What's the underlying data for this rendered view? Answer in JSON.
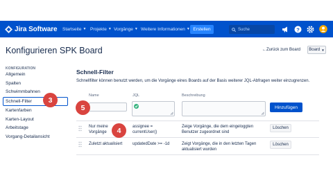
{
  "nav": {
    "logo_text": "Jira Software",
    "menu": [
      {
        "label": "Startseite"
      },
      {
        "label": "Projekte"
      },
      {
        "label": "Vorgänge"
      },
      {
        "label": "Weitere Informationen"
      }
    ],
    "create_label": "Erstellen",
    "search_placeholder": "Suche",
    "icons": [
      "megaphone-icon",
      "help-icon",
      "settings-icon",
      "user-avatar-icon"
    ]
  },
  "header": {
    "title": "Konfigurieren SPK Board",
    "back_link": "Zurück zum Board",
    "board_button": "Board"
  },
  "sidebar": {
    "heading": "KONFIGURATION",
    "items": [
      {
        "label": "Allgemein"
      },
      {
        "label": "Spalten"
      },
      {
        "label": "Schwimmbahnen"
      },
      {
        "label": "Schnell-Filter"
      },
      {
        "label": "Kartenfarben"
      },
      {
        "label": "Karten-Layout"
      },
      {
        "label": "Arbeitstage"
      },
      {
        "label": "Vorgang-Detailansicht"
      }
    ]
  },
  "main": {
    "title": "Schnell-Filter",
    "description": "Schnellfilter können benutzt werden, um die Vorgänge eines Boards auf der Basis weiterer JQL-Abfragen weiter einzugrenzen.",
    "columns": {
      "name": "Name",
      "jql": "JQL",
      "description": "Beschreibung"
    },
    "add_button": "Hinzufügen",
    "filters": [
      {
        "name_line1": "Nur meine",
        "name_line2": "Vorgänge",
        "jql_line1": "assignee =",
        "jql_line2": "currentUser()",
        "desc_line1": "Zeige Vorgänge, die dem eingeloggten",
        "desc_line2": "Benutzer zugeordnet sind",
        "delete_label": "Löschen"
      },
      {
        "name_line1": "Zuletzt aktualisiert",
        "name_line2": "",
        "jql_line1": "updatedDate >= -1d",
        "jql_line2": "",
        "desc_line1": "Zeigt Vorgänge, die in den letzten Tagen",
        "desc_line2": "aktualisiert wurden",
        "delete_label": "Löschen"
      }
    ]
  },
  "callouts": {
    "sidebar": "3",
    "filter_row": "4",
    "name_input": "5"
  },
  "colors": {
    "nav": "#0052cc",
    "primary": "#0052cc",
    "badge": "#d9443f",
    "valid": "#36b37e"
  }
}
